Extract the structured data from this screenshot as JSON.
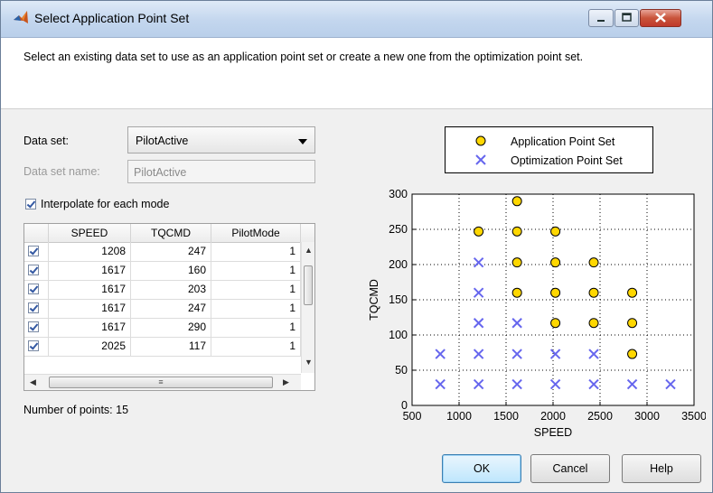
{
  "window": {
    "title": "Select Application Point Set"
  },
  "description": "Select an existing data set to use as an application point set or create a new one from the optimization point set.",
  "form": {
    "data_set_label": "Data set:",
    "data_set_value": "PilotActive",
    "data_set_name_label": "Data set name:",
    "data_set_name_value": "PilotActive",
    "interpolate_label": "Interpolate for each mode",
    "interpolate_checked": true
  },
  "table": {
    "columns": [
      "SPEED",
      "TQCMD",
      "PilotMode"
    ],
    "rows": [
      {
        "checked": true,
        "speed": "1208",
        "tqcmd": "247",
        "mode": "1"
      },
      {
        "checked": true,
        "speed": "1617",
        "tqcmd": "160",
        "mode": "1"
      },
      {
        "checked": true,
        "speed": "1617",
        "tqcmd": "203",
        "mode": "1"
      },
      {
        "checked": true,
        "speed": "1617",
        "tqcmd": "247",
        "mode": "1"
      },
      {
        "checked": true,
        "speed": "1617",
        "tqcmd": "290",
        "mode": "1"
      },
      {
        "checked": true,
        "speed": "2025",
        "tqcmd": "117",
        "mode": "1"
      }
    ]
  },
  "points_count_text": "Number of points: 15",
  "chart_data": {
    "type": "scatter",
    "xlabel": "SPEED",
    "ylabel": "TQCMD",
    "xlim": [
      500,
      3500
    ],
    "ylim": [
      0,
      300
    ],
    "xticks": [
      "500",
      "1000",
      "1500",
      "2000",
      "2500",
      "3000",
      "3500"
    ],
    "yticks": [
      "0",
      "50",
      "100",
      "150",
      "200",
      "250",
      "300"
    ],
    "grid": true,
    "legend_position": "top",
    "series": [
      {
        "name": "Application Point Set",
        "marker": "circle",
        "color": "#ffd700",
        "points": [
          [
            1208,
            247
          ],
          [
            1617,
            290
          ],
          [
            1617,
            247
          ],
          [
            1617,
            203
          ],
          [
            1617,
            160
          ],
          [
            2025,
            247
          ],
          [
            2025,
            203
          ],
          [
            2025,
            160
          ],
          [
            2025,
            117
          ],
          [
            2433,
            203
          ],
          [
            2433,
            160
          ],
          [
            2433,
            117
          ],
          [
            2842,
            160
          ],
          [
            2842,
            117
          ],
          [
            2842,
            73
          ]
        ]
      },
      {
        "name": "Optimization Point Set",
        "marker": "x",
        "color": "#6666ee",
        "points": [
          [
            800,
            73
          ],
          [
            800,
            30
          ],
          [
            1208,
            203
          ],
          [
            1208,
            160
          ],
          [
            1208,
            117
          ],
          [
            1208,
            73
          ],
          [
            1208,
            30
          ],
          [
            1617,
            117
          ],
          [
            1617,
            73
          ],
          [
            1617,
            30
          ],
          [
            2025,
            73
          ],
          [
            2025,
            30
          ],
          [
            2433,
            73
          ],
          [
            2433,
            30
          ],
          [
            2842,
            30
          ],
          [
            3250,
            30
          ]
        ]
      }
    ]
  },
  "buttons": {
    "ok": "OK",
    "cancel": "Cancel",
    "help": "Help"
  }
}
